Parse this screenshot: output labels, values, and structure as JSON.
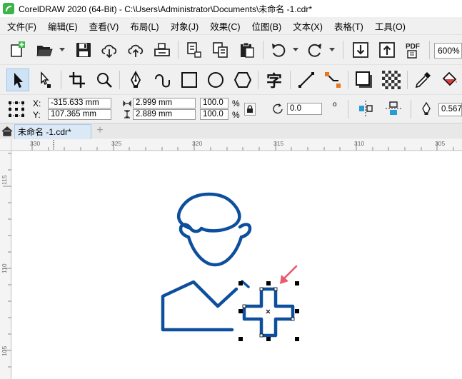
{
  "window": {
    "title": "CorelDRAW 2020 (64-Bit) - C:\\Users\\Administrator\\Documents\\未命名 -1.cdr*"
  },
  "menu": [
    "文件(F)",
    "编辑(E)",
    "查看(V)",
    "布局(L)",
    "对象(J)",
    "效果(C)",
    "位图(B)",
    "文本(X)",
    "表格(T)",
    "工具(O)"
  ],
  "standard_toolbar": {
    "pdf_label": "PDF",
    "zoom": "600%"
  },
  "toolbox": {
    "text_tool_glyph": "字"
  },
  "property_bar": {
    "x_label": "X:",
    "x_value": "-315.633 mm",
    "y_label": "Y:",
    "y_value": "107.365 mm",
    "width_value": "2.999 mm",
    "height_value": "2.889 mm",
    "scale_x": "100.0",
    "scale_y": "100.0",
    "percent_x": "%",
    "percent_y": "%",
    "rotation_value": "0.0",
    "degree_symbol": "o",
    "outline_width": "0.567"
  },
  "document_tabs": [
    {
      "label": "未命名 -1.cdr*"
    }
  ],
  "ruler": {
    "horizontal": [
      "330",
      "325",
      "320",
      "315",
      "310",
      "305"
    ],
    "vertical": [
      "115",
      "110",
      "105"
    ]
  },
  "colors": {
    "shape_stroke": "#0d4f9c",
    "selection_handle": "#000000",
    "arrow_accent": "#e85a6c",
    "active_tool": "#cfe3f7"
  },
  "icons": [
    "new-document-icon",
    "open-folder-icon",
    "save-icon",
    "cloud-download-icon",
    "cloud-upload-icon",
    "print-icon",
    "undo-icon",
    "redo-icon",
    "import-icon",
    "export-icon",
    "pick-tool-icon",
    "shape-tool-icon",
    "crop-tool-icon",
    "zoom-tool-icon",
    "pen-tool-icon",
    "freehand-tool-icon",
    "rectangle-tool-icon",
    "ellipse-tool-icon",
    "polygon-tool-icon",
    "line-tool-icon",
    "connector-tool-icon",
    "drop-shadow-icon",
    "transparency-icon",
    "eyedropper-icon",
    "fill-tool-icon",
    "lock-icon",
    "home-icon"
  ]
}
